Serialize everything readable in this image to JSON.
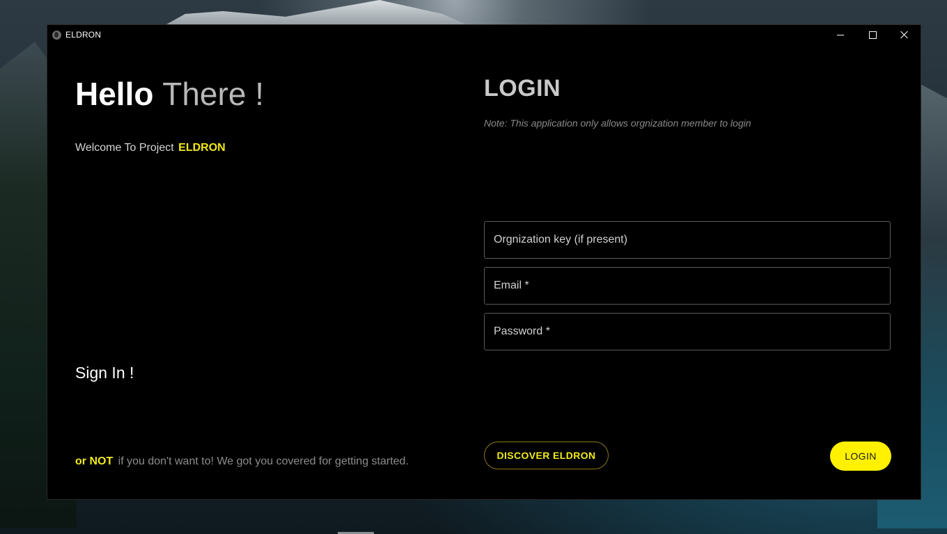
{
  "window": {
    "title": "ELDRON",
    "icon": "globe-icon",
    "controls": [
      "minimize-icon",
      "maximize-icon",
      "close-icon"
    ]
  },
  "left": {
    "hello_bold": "Hello",
    "hello_light": "There !",
    "welcome_text": "Welcome To Project",
    "welcome_brand": "ELDRON",
    "signin": "Sign In !",
    "footer_or_not": "or NOT",
    "footer_rest": "if you don't want to! We got you covered for getting started."
  },
  "login": {
    "title": "LOGIN",
    "note": "Note: This application only allows orgnization member to login",
    "org_placeholder": "Orgnization key (if present)",
    "email_placeholder": "Email *",
    "password_placeholder": "Password *",
    "discover_label": "DISCOVER ELDRON",
    "login_label": "LOGIN"
  },
  "colors": {
    "accent": "#fff100",
    "background": "#000000",
    "muted_text": "#8d8d8d"
  }
}
